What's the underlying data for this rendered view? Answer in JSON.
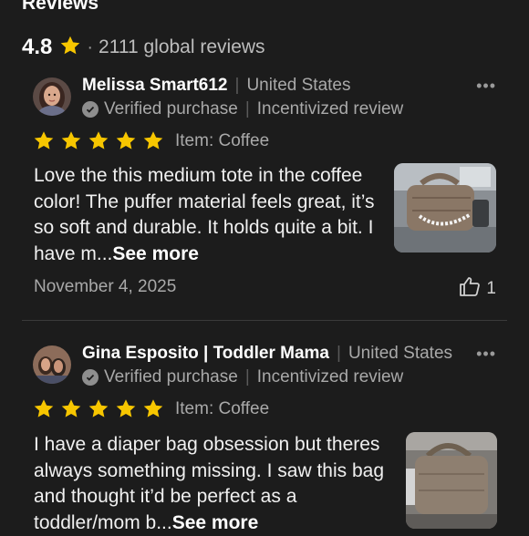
{
  "section": {
    "heading": "Reviews",
    "rating": "4.8",
    "dot": "·",
    "review_count": "2111 global reviews",
    "star_color": "#f7c600"
  },
  "reviews": [
    {
      "name": "Melissa Smart612",
      "separator": "|",
      "country": "United States",
      "verified": "Verified purchase",
      "incentivized": "Incentivized review",
      "stars": 5,
      "item": "Item: Coffee",
      "text": "Love the this medium tote in the coffee color! The puffer material feels great, it’s so soft and durable. It holds quite a bit. I have m...",
      "see_more": "See more",
      "date": "November 4, 2025",
      "likes": "1"
    },
    {
      "name": "Gina Esposito | Toddler Mama",
      "separator": "|",
      "country": "United States",
      "verified": "Verified purchase",
      "incentivized": "Incentivized review",
      "stars": 5,
      "item": "Item: Coffee",
      "text": "I have a diaper bag obsession but theres always something missing. I saw this bag and thought it’d be perfect as a toddler/mom b...",
      "see_more": "See more"
    }
  ]
}
